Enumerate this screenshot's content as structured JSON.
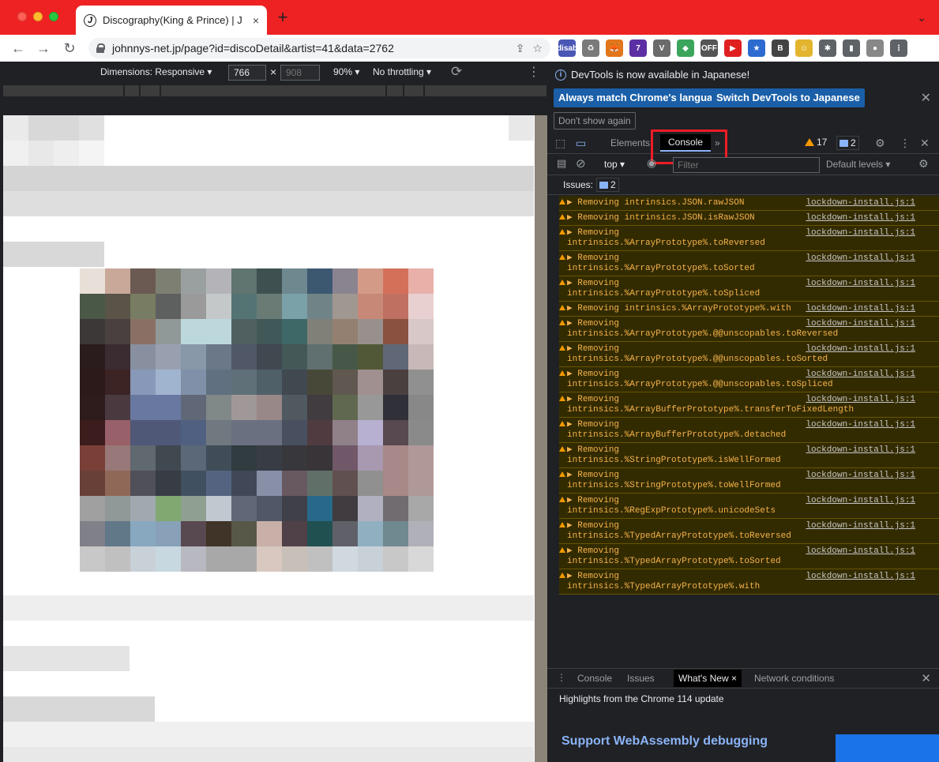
{
  "browser": {
    "tab": {
      "favicon": "J",
      "title": "Discography(King & Prince) | J",
      "close": "×"
    },
    "new_tab": "+",
    "url": "johnnys-net.jp/page?id=discoDetail&artist=41&data=2762",
    "extensions": [
      {
        "name": "disab-icon",
        "label": "disab",
        "color": "#4a57b5"
      },
      {
        "name": "recycle-icon",
        "label": "♻",
        "color": "#7a7a7a"
      },
      {
        "name": "metamask-icon",
        "label": "🦊",
        "color": "#e2761b"
      },
      {
        "name": "ext-purple-icon",
        "label": "7",
        "color": "#5b2fa3"
      },
      {
        "name": "ext-v-icon",
        "label": "V",
        "color": "#6b6b6b"
      },
      {
        "name": "ext-diamond-icon",
        "label": "◆",
        "color": "#3ba55c"
      },
      {
        "name": "ext-off-icon",
        "label": "OFF",
        "color": "#555555"
      },
      {
        "name": "ext-youtube-icon",
        "label": "▶",
        "color": "#e02020"
      },
      {
        "name": "ext-star-icon",
        "label": "★",
        "color": "#2d6bd1"
      },
      {
        "name": "ext-b-icon",
        "label": "B",
        "color": "#444444"
      },
      {
        "name": "ext-face-icon",
        "label": "☺",
        "color": "#e3b52f"
      },
      {
        "name": "puzzle-icon",
        "label": "✱",
        "color": "#5f6368"
      },
      {
        "name": "sidepanel-icon",
        "label": "▮",
        "color": "#5f6368"
      },
      {
        "name": "avatar-icon",
        "label": "●",
        "color": "#888888"
      },
      {
        "name": "kebab-icon",
        "label": "⋮",
        "color": "#5f6368"
      }
    ]
  },
  "device_toolbar": {
    "dimensions": "Dimensions: Responsive ▾",
    "width": "766",
    "height": "908",
    "times": "×",
    "zoom": "90% ▾",
    "throttling": "No throttling ▾"
  },
  "devtools": {
    "info": {
      "text": "DevTools is now available in Japanese!",
      "btn_match": "Always match Chrome's language",
      "btn_switch": "Switch DevTools to Japanese",
      "dont_show": "Don't show again"
    },
    "tabs": {
      "elements": "Elements",
      "console": "Console",
      "more": "»"
    },
    "warnings": "17",
    "messages": "2",
    "console_toolbar": {
      "context": "top ▾",
      "filter_placeholder": "Filter",
      "levels": "Default levels ▾"
    },
    "issues": {
      "label": "Issues:",
      "count": "2"
    },
    "logs": [
      {
        "msg": "▶ Removing intrinsics.JSON.rawJSON",
        "cont": "",
        "src": "lockdown-install.js:1"
      },
      {
        "msg": "▶ Removing intrinsics.JSON.isRawJSON",
        "cont": "",
        "src": "lockdown-install.js:1"
      },
      {
        "msg": "▶ Removing",
        "cont": "intrinsics.%ArrayPrototype%.toReversed",
        "src": "lockdown-install.js:1"
      },
      {
        "msg": "▶ Removing",
        "cont": "intrinsics.%ArrayPrototype%.toSorted",
        "src": "lockdown-install.js:1"
      },
      {
        "msg": "▶ Removing",
        "cont": "intrinsics.%ArrayPrototype%.toSpliced",
        "src": "lockdown-install.js:1"
      },
      {
        "msg": "▶ Removing intrinsics.%ArrayPrototype%.with",
        "cont": "",
        "src": "lockdown-install.js:1"
      },
      {
        "msg": "▶ Removing",
        "cont": "intrinsics.%ArrayPrototype%.@@unscopables.toReversed",
        "src": "lockdown-install.js:1"
      },
      {
        "msg": "▶ Removing",
        "cont": "intrinsics.%ArrayPrototype%.@@unscopables.toSorted",
        "src": "lockdown-install.js:1"
      },
      {
        "msg": "▶ Removing",
        "cont": "intrinsics.%ArrayPrototype%.@@unscopables.toSpliced",
        "src": "lockdown-install.js:1"
      },
      {
        "msg": "▶ Removing",
        "cont": "intrinsics.%ArrayBufferPrototype%.transferToFixedLength",
        "src": "lockdown-install.js:1"
      },
      {
        "msg": "▶ Removing",
        "cont": "intrinsics.%ArrayBufferPrototype%.detached",
        "src": "lockdown-install.js:1"
      },
      {
        "msg": "▶ Removing",
        "cont": "intrinsics.%StringPrototype%.isWellFormed",
        "src": "lockdown-install.js:1"
      },
      {
        "msg": "▶ Removing",
        "cont": "intrinsics.%StringPrototype%.toWellFormed",
        "src": "lockdown-install.js:1"
      },
      {
        "msg": "▶ Removing",
        "cont": "intrinsics.%RegExpPrototype%.unicodeSets",
        "src": "lockdown-install.js:1"
      },
      {
        "msg": "▶ Removing",
        "cont": "intrinsics.%TypedArrayPrototype%.toReversed",
        "src": "lockdown-install.js:1"
      },
      {
        "msg": "▶ Removing",
        "cont": "intrinsics.%TypedArrayPrototype%.toSorted",
        "src": "lockdown-install.js:1"
      },
      {
        "msg": "▶ Removing",
        "cont": "intrinsics.%TypedArrayPrototype%.with",
        "src": "lockdown-install.js:1"
      }
    ],
    "drawer": {
      "tabs": [
        "Console",
        "Issues",
        "What's New",
        "Network conditions"
      ],
      "active_close": "×",
      "highlights": "Highlights from the Chrome 114 update",
      "whats_new_title": "Support WebAssembly debugging"
    }
  },
  "colors": {
    "titlebar": "#ee2222",
    "highlight": "#ee1c25",
    "warning": "#f5b24c"
  }
}
